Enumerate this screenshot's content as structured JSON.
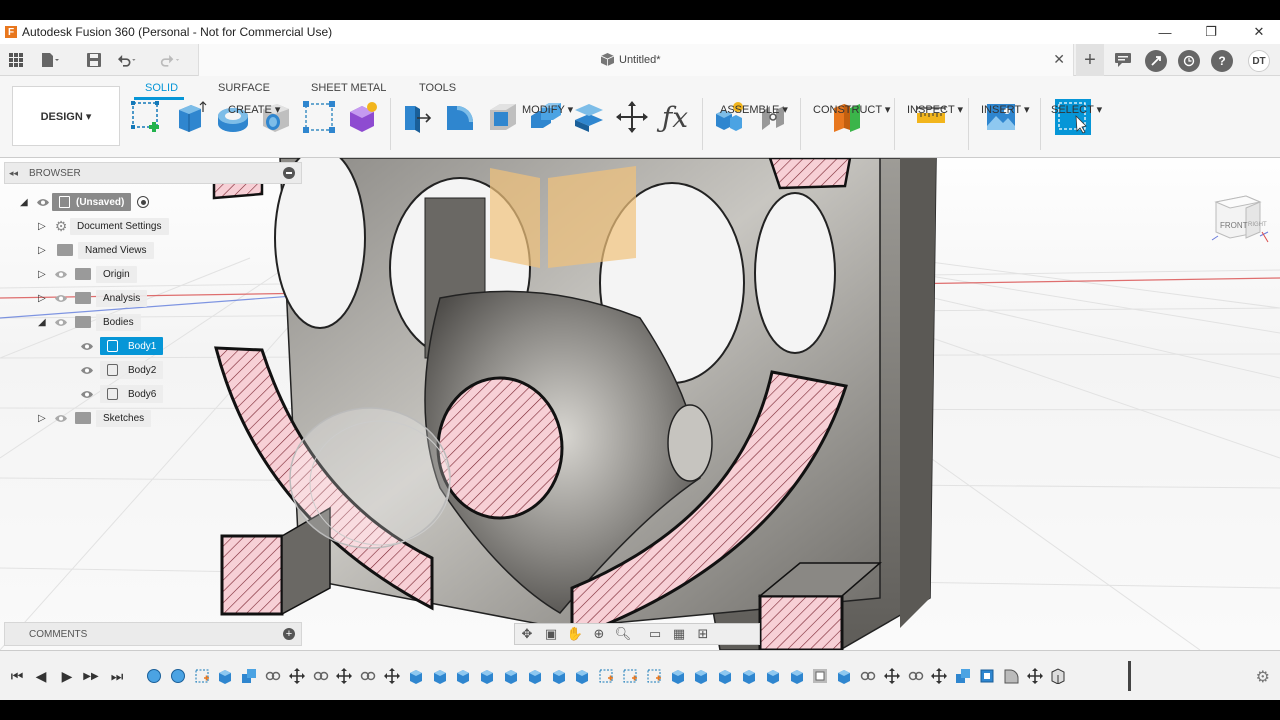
{
  "window": {
    "title": "Autodesk Fusion 360 (Personal - Not for Commercial Use)",
    "minimize": "—",
    "maximize": "❐",
    "close": "✕"
  },
  "quickaccess": {
    "document_title": "Untitled*",
    "close": "✕",
    "user_initials": "DT",
    "add": "+"
  },
  "ribbon": {
    "workspace": "DESIGN ▾",
    "tabs": [
      "SOLID",
      "SURFACE",
      "SHEET METAL",
      "TOOLS"
    ],
    "active_tab": "SOLID",
    "groups": [
      "CREATE ▾",
      "MODIFY ▾",
      "ASSEMBLE ▾",
      "CONSTRUCT ▾",
      "INSPECT ▾",
      "INSERT ▾",
      "SELECT ▾"
    ],
    "accent": "#0696d7"
  },
  "browser": {
    "title": "BROWSER",
    "collapse": "◂◂",
    "items": [
      {
        "label": "(Unsaved)"
      },
      {
        "label": "Document Settings"
      },
      {
        "label": "Named Views"
      },
      {
        "label": "Origin"
      },
      {
        "label": "Analysis"
      },
      {
        "label": "Bodies"
      },
      {
        "label": "Body1"
      },
      {
        "label": "Body2"
      },
      {
        "label": "Body6"
      },
      {
        "label": "Sketches"
      }
    ]
  },
  "viewcube": {
    "front": "FRONT",
    "right": "RIGHT"
  },
  "comments": {
    "title": "COMMENTS"
  },
  "navbar": {
    "icons": [
      "orbit-icon",
      "look-at-icon",
      "pan-icon",
      "zoom-icon",
      "fit-icon",
      "display-settings-icon",
      "grid-icon",
      "viewports-icon"
    ]
  },
  "timeline": {
    "controls": [
      "⏮",
      "◀",
      "▶",
      "▶▶",
      "⏭"
    ],
    "features": [
      "sphere",
      "sphere",
      "sketch",
      "extrude",
      "combine",
      "joint",
      "move",
      "joint",
      "move",
      "joint",
      "move",
      "extrude",
      "extrude",
      "extrude",
      "extrude",
      "extrude",
      "extrude",
      "extrude",
      "extrude",
      "sketch",
      "sketch",
      "sketch",
      "extrude",
      "extrude",
      "extrude",
      "extrude",
      "extrude",
      "extrude",
      "shell",
      "extrude",
      "joint",
      "move",
      "joint",
      "move",
      "combine",
      "box",
      "fillet",
      "move",
      "section"
    ]
  }
}
